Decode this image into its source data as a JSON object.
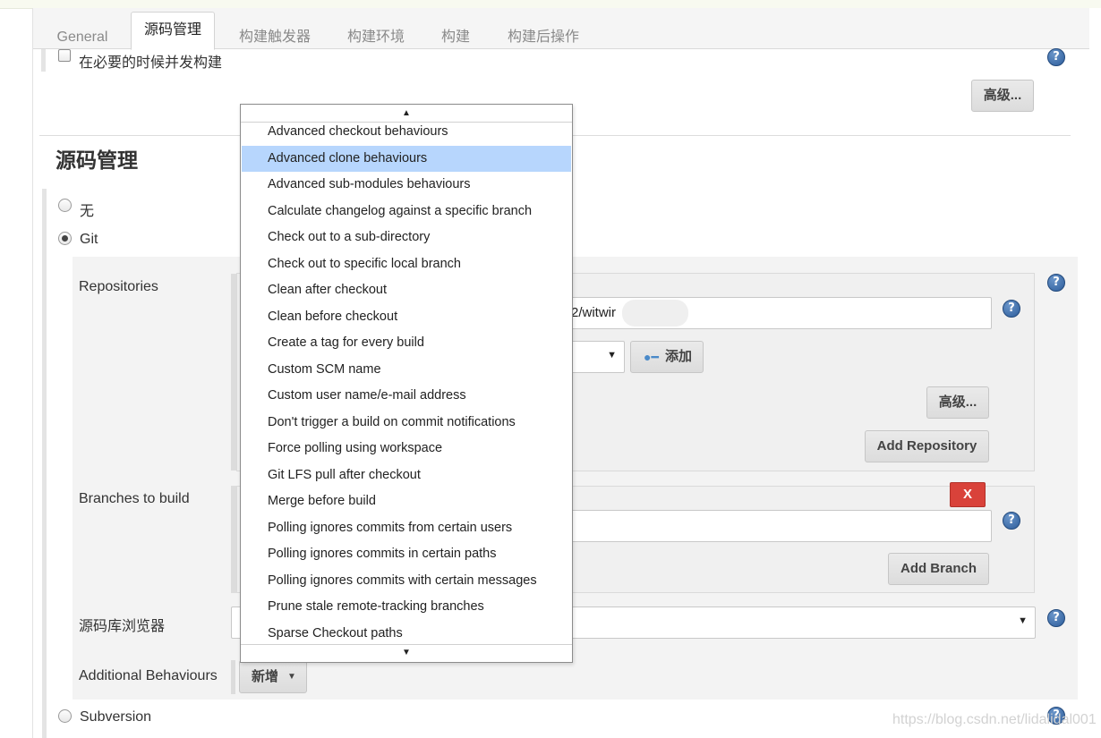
{
  "tabs": [
    "General",
    "源码管理",
    "构建触发器",
    "构建环境",
    "构建",
    "构建后操作"
  ],
  "concurrent_build_label": "在必要的时候并发构建",
  "advanced_label": "高级...",
  "section_title": "源码管理",
  "scm_options": {
    "none": "无",
    "git": "Git",
    "svn": "Subversion"
  },
  "repositories_label": "Repositories",
  "repo_url_value": "2/witwir",
  "add_credentials_label": "添加",
  "add_repository_label": "Add Repository",
  "branches_label": "Branches to build",
  "delete_branch_label": "X",
  "add_branch_label": "Add Branch",
  "browser_label": "源码库浏览器",
  "additional_behaviours_label": "Additional Behaviours",
  "add_new_label": "新增",
  "dropdown_items": [
    "Advanced checkout behaviours",
    "Advanced clone behaviours",
    "Advanced sub-modules behaviours",
    "Calculate changelog against a specific branch",
    "Check out to a sub-directory",
    "Check out to specific local branch",
    "Clean after checkout",
    "Clean before checkout",
    "Create a tag for every build",
    "Custom SCM name",
    "Custom user name/e-mail address",
    "Don't trigger a build on commit notifications",
    "Force polling using workspace",
    "Git LFS pull after checkout",
    "Merge before build",
    "Polling ignores commits from certain users",
    "Polling ignores commits in certain paths",
    "Polling ignores commits with certain messages",
    "Prune stale remote-tracking branches",
    "Sparse Checkout paths"
  ],
  "watermark": "https://blog.csdn.net/lidalidal001",
  "colors": {
    "highlight": "#b7d6fd",
    "danger": "#d9423a",
    "help": "#2d5d9b"
  }
}
